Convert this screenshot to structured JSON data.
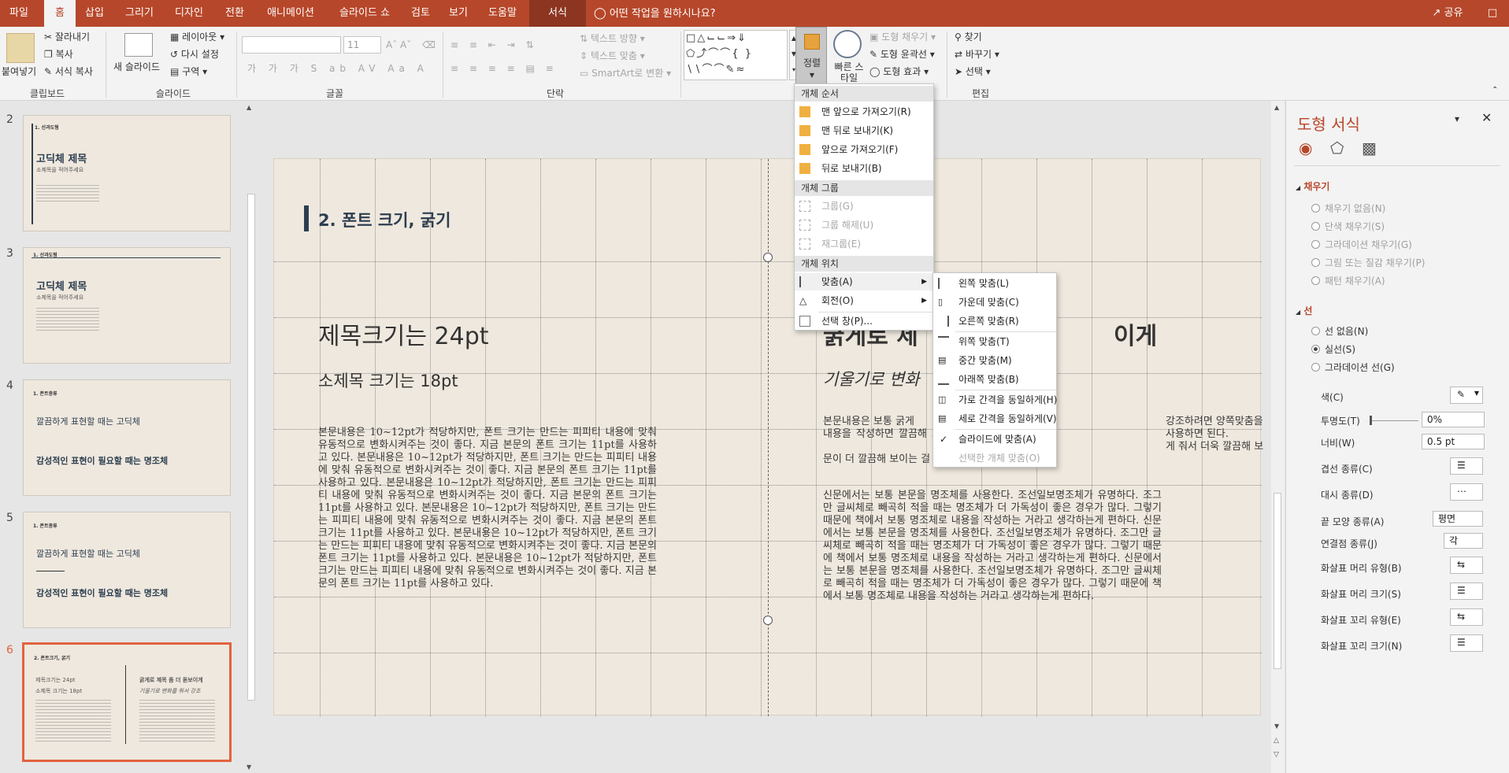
{
  "colors": {
    "accent": "#b7472a",
    "slide_bg": "#efe8de",
    "title_bar": "#2c3e50",
    "selection": "#e2633f"
  },
  "tabs": [
    "파일",
    "홈",
    "삽입",
    "그리기",
    "디자인",
    "전환",
    "애니메이션",
    "슬라이드 쇼",
    "검토",
    "보기",
    "도움말",
    "서식"
  ],
  "tell_me": "어떤 작업을 원하시나요?",
  "share": "공유",
  "ribbon": {
    "clipboard": {
      "paste": "붙여넣기",
      "cut": "잘라내기",
      "copy": "복사",
      "format_painter": "서식 복사",
      "label": "클립보드"
    },
    "slides": {
      "new_slide": "새 슬라이드",
      "layout": "레이아웃",
      "reset": "다시 설정",
      "section": "구역",
      "label": "슬라이드"
    },
    "font": {
      "size": "11",
      "label": "글꼴"
    },
    "paragraph": {
      "text_direction": "텍스트 방향",
      "align_text": "텍스트 맞춤",
      "smartart": "SmartArt로 변환",
      "label": "단락"
    },
    "drawing": {
      "arrange": "정렬",
      "quick_styles": "빠른 스타일",
      "shape_fill": "도형 채우기",
      "shape_outline": "도형 윤곽선",
      "shape_effects": "도형 효과"
    },
    "editing": {
      "find": "찾기",
      "replace": "바꾸기",
      "select": "선택",
      "label": "편집"
    }
  },
  "thumbnails": [
    {
      "num": "2",
      "small": "1. 선과도형",
      "title": "고딕체 제목",
      "sub": "소제목을 적어주세요"
    },
    {
      "num": "3",
      "small": "1. 선과도형",
      "title": "고딕체 제목",
      "sub": "소제목을 적어주세요"
    },
    {
      "num": "4",
      "small": "1. 폰트종류",
      "line1": "깔끔하게 표현할 때는 고딕체",
      "line2": "감성적인 표현이 필요할 때는 명조체"
    },
    {
      "num": "5",
      "small": "1. 폰트종류",
      "line1": "깔끔하게 표현할 때는 고딕체",
      "line2": "감성적인 표현이 필요할 때는 명조체"
    },
    {
      "num": "6",
      "small": "2. 폰트크기, 굵기",
      "left1": "제목크기는 24pt",
      "left2": "소제목 크기는 18pt",
      "right1": "굵게로 제목 좀 더 돋보이게",
      "right2": "기울기로 변화를 줘서 강조"
    }
  ],
  "slide": {
    "heading": "2. 폰트 크기, 굵기",
    "left_title": "제목크기는 24pt",
    "left_sub": "소제목 크기는 18pt",
    "left_body": "본문내용은 10~12pt가 적당하지만, 폰트 크기는 만드는 피피티 내용에 맞춰 유동적으로 변화시켜주는 것이 좋다. 지금 본문의 폰트 크기는 11pt를 사용하고 있다. 본문내용은 10~12pt가 적당하지만, 폰트 크기는 만드는 피피티 내용에 맞춰 유동적으로 변화시켜주는 것이 좋다. 지금 본문의 폰트 크기는 11pt를 사용하고 있다. 본문내용은 10~12pt가 적당하지만, 폰트 크기는 만드는 피피티 내용에 맞춰 유동적으로 변화시켜주는 것이 좋다. 지금 본문의 폰트 크기는 11pt를 사용하고 있다. 본문내용은 10~12pt가 적당하지만, 폰트 크기는 만드는 피피티 내용에 맞춰 유동적으로 변화시켜주는 것이 좋다. 지금 본문의 폰트 크기는 11pt를 사용하고 있다.\n본문내용은 10~12pt가 적당하지만, 폰트 크기는 만드는 피피티 내용에 맞춰 유동적으로 변화시켜주는 것이 좋다. 지금 본문의 폰트 크기는 11pt를 사용하고 있다. 본문내용은 10~12pt가 적당하지만, 폰트 크기는 만드는 피피티 내용에 맞춰 유동적으로 변화시켜주는 것이 좋다. 지금 본문의 폰트 크기는 11pt를 사용하고 있다.",
    "right_title": "굵게로 제",
    "right_title_end": "이게",
    "right_sub": "기울기로 변화",
    "right_body1": "본문내용은 보통 굵게",
    "right_body1b": "내용을 작성하면 깔끔해 보인다. 본문",
    "right_body1c": "강조하려면 양쪽맞춤을 사용하면 된다.",
    "right_body1d": "게 줘서 더욱 깔끔해 보인다. 왼쪽 본문",
    "right_body1e": "문이 더 깔끔해 보이는 걸 확인할 수 있다.",
    "right_body2": "신문에서는 보통 본문을 명조체를 사용한다. 조선일보명조체가 유명하다. 조그만 글씨체로 빼곡히 적을 때는 명조체가 더 가독성이 좋은 경우가 많다. 그렇기 때문에 책에서 보통 명조체로 내용을 작성하는 거라고 생각하는게 편하다.\n신문에서는 보통 본문을 명조체를 사용한다. 조선일보명조체가 유명하다. 조그만 글씨체로 빼곡히 적을 때는 명조체가 더 가독성이 좋은 경우가 많다. 그렇기 때문에 책에서 보통 명조체로 내용을 작성하는 거라고 생각하는게 편하다.\n신문에서는 보통 본문을 명조체를 사용한다. 조선일보명조체가 유명하다. 조그만 글씨체로 빼곡히 적을 때는 명조체가 더 가독성이 좋은 경우가 많다. 그렇기 때문에 책에서 보통 명조체로 내용을 작성하는 거라고 생각하는게 편하다."
  },
  "arrange_menu": {
    "h1": "개체 순서",
    "bring_front": "맨 앞으로 가져오기(R)",
    "send_back": "맨 뒤로 보내기(K)",
    "bring_forward": "앞으로 가져오기(F)",
    "send_backward": "뒤로 보내기(B)",
    "h2": "개체 그룹",
    "group": "그룹(G)",
    "ungroup": "그룹 해제(U)",
    "regroup": "재그룹(E)",
    "h3": "개체 위치",
    "align": "맞춤(A)",
    "rotate": "회전(O)",
    "selection_pane": "선택 창(P)..."
  },
  "align_menu": {
    "left": "왼쪽 맞춤(L)",
    "center": "가운데 맞춤(C)",
    "right": "오른쪽 맞춤(R)",
    "top": "위쪽 맞춤(T)",
    "middle": "중간 맞춤(M)",
    "bottom": "아래쪽 맞춤(B)",
    "dist_h": "가로 간격을 동일하게(H)",
    "dist_v": "세로 간격을 동일하게(V)",
    "to_slide": "슬라이드에 맞춤(A)",
    "to_selected": "선택한 개체 맞춤(O)"
  },
  "taskpane": {
    "title": "도형 서식",
    "fill_header": "채우기",
    "fill_none": "채우기 없음(N)",
    "fill_solid": "단색 채우기(S)",
    "fill_gradient": "그라데이션 채우기(G)",
    "fill_picture": "그림 또는 질감 채우기(P)",
    "fill_pattern": "패턴 채우기(A)",
    "line_header": "선",
    "line_none": "선 없음(N)",
    "line_solid": "실선(S)",
    "line_gradient": "그라데이션 선(G)",
    "color": "색(C)",
    "transparency": "투명도(T)",
    "transparency_val": "0%",
    "width": "너비(W)",
    "width_val": "0.5 pt",
    "compound": "겹선 종류(C)",
    "dash": "대시 종류(D)",
    "cap": "끝 모양 종류(A)",
    "cap_val": "평면",
    "join": "연결점 종류(J)",
    "join_val": "각",
    "begin_arrow_type": "화살표 머리 유형(B)",
    "begin_arrow_size": "화살표 머리 크기(S)",
    "end_arrow_type": "화살표 꼬리 유형(E)",
    "end_arrow_size": "화살표 꼬리 크기(N)"
  }
}
